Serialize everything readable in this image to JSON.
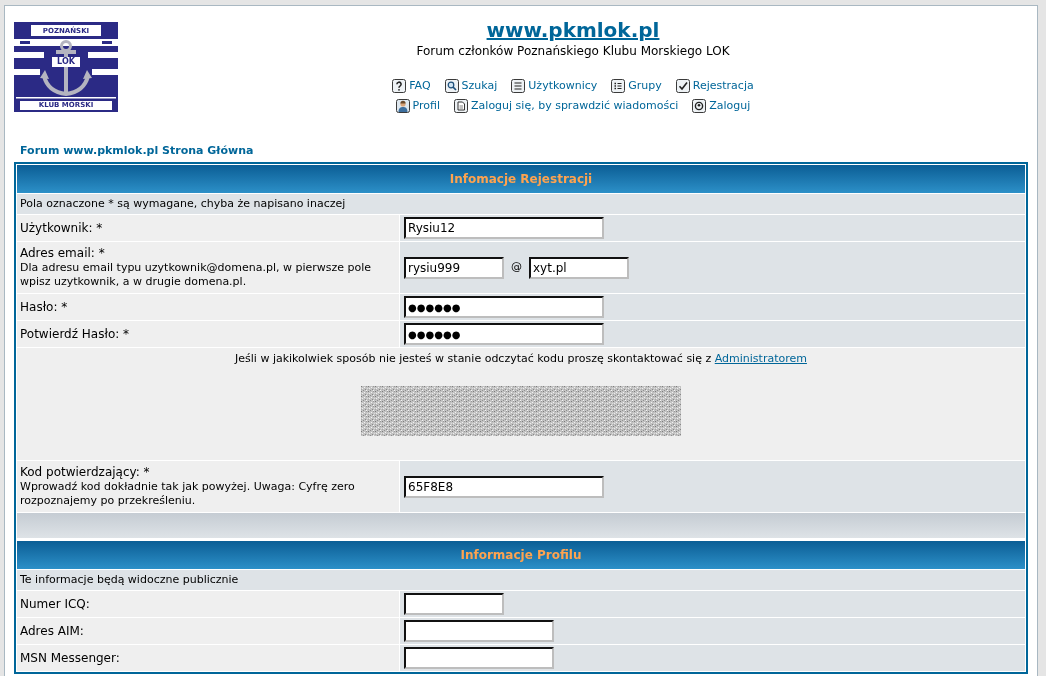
{
  "logo": {
    "top_text": "POZNAŃSKI",
    "center_text": "LOK",
    "bottom_text": "KLUB MORSKI"
  },
  "header": {
    "title": "www.pkmlok.pl",
    "subtitle": "Forum członków Poznańskiego Klubu Morskiego LOK"
  },
  "nav_rows": [
    {
      "links": [
        {
          "kind": "faq",
          "label": "FAQ"
        },
        {
          "kind": "search",
          "label": "Szukaj"
        },
        {
          "kind": "members",
          "label": "Użytkownicy"
        },
        {
          "kind": "groups",
          "label": "Grupy"
        },
        {
          "kind": "register",
          "label": "Rejestracja"
        }
      ]
    },
    {
      "links": [
        {
          "kind": "profile",
          "label": "Profil"
        },
        {
          "kind": "messages",
          "label": "Zaloguj się, by sprawdzić wiadomości"
        },
        {
          "kind": "login",
          "label": "Zaloguj"
        }
      ]
    }
  ],
  "breadcrumb": "Forum www.pkmlok.pl Strona Główna",
  "sections": [
    {
      "title": "Infomacje Rejestracji",
      "note": "Pola oznaczone * są wymagane, chyba że napisano inaczej",
      "rows": [
        {
          "kind": "field",
          "label": "Użytkownik: *",
          "inputs": [
            {
              "kind": "text",
              "value": "Rysiu12"
            }
          ]
        },
        {
          "kind": "field",
          "label": "Adres email: *",
          "hint": "Dla adresu email typu uzytkownik@domena.pl, w pierwsze pole wpisz uzytkownik, a w drugie domena.pl.",
          "separator": "@",
          "inputs": [
            {
              "kind": "text",
              "value": "rysiu999"
            },
            {
              "kind": "text",
              "value": "xyt.pl"
            }
          ]
        },
        {
          "kind": "field",
          "label": "Hasło: *",
          "inputs": [
            {
              "kind": "password",
              "value": "●●●●●●"
            }
          ]
        },
        {
          "kind": "field",
          "label": "Potwierdź Hasło: *",
          "inputs": [
            {
              "kind": "password",
              "value": "●●●●●●"
            }
          ]
        },
        {
          "kind": "captcha",
          "text": "Jeśli w jakikolwiek sposób nie jesteś w stanie odczytać kodu proszę skontaktować się z",
          "link": "Administratorem"
        },
        {
          "kind": "field",
          "label": "Kod potwierdzający: *",
          "hint": "Wprowadź kod dokładnie tak jak powyżej. Uwaga: Cyfrę zero rozpoznajemy po przekreśleniu.",
          "inputs": [
            {
              "kind": "text",
              "value": "65F8E8"
            }
          ]
        },
        {
          "kind": "spacer"
        }
      ]
    },
    {
      "title": "Informacje Profilu",
      "note": "Te informacje będą widoczne publicznie",
      "rows": [
        {
          "kind": "field",
          "label": "Numer ICQ:",
          "inputs": [
            {
              "kind": "text"
            }
          ]
        },
        {
          "kind": "field",
          "label": "Adres AIM:",
          "inputs": [
            {
              "kind": "text"
            }
          ]
        },
        {
          "kind": "field",
          "label": "MSN Messenger:",
          "inputs": [
            {
              "kind": "text"
            }
          ]
        }
      ]
    }
  ]
}
